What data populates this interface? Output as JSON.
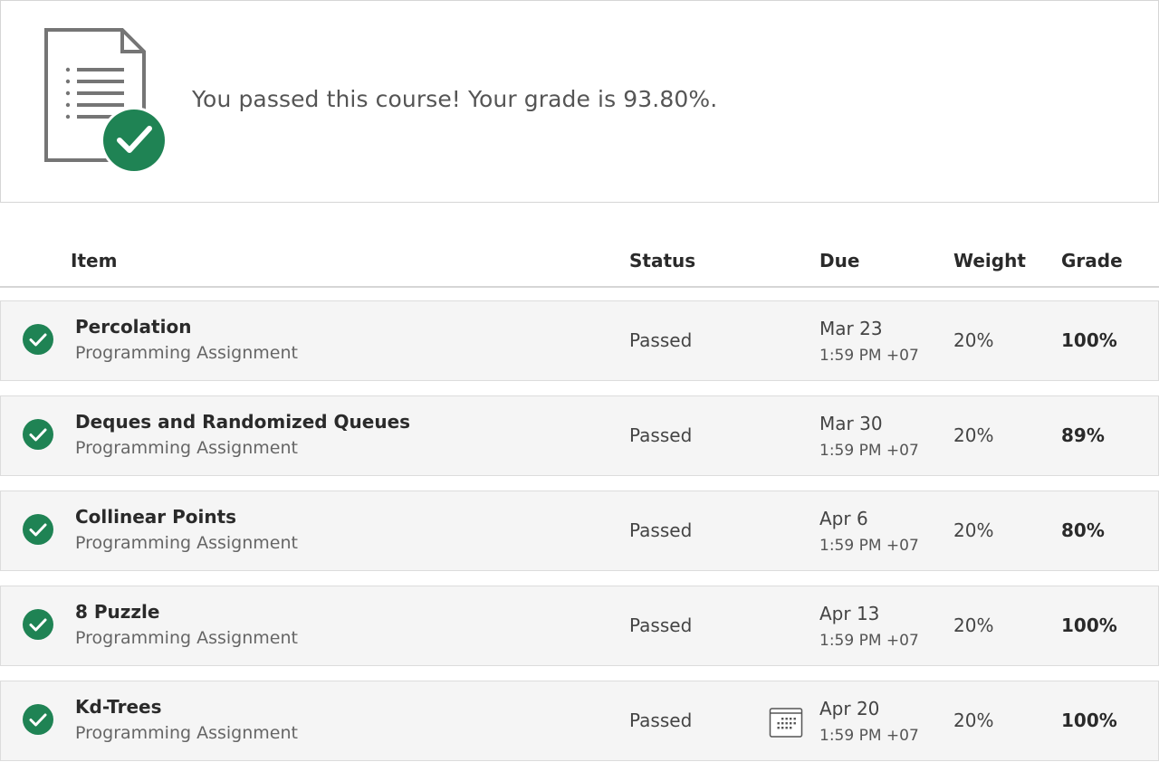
{
  "banner": {
    "message": "You passed this course! Your grade is 93.80%."
  },
  "table": {
    "headers": {
      "item": "Item",
      "status": "Status",
      "due": "Due",
      "weight": "Weight",
      "grade": "Grade"
    },
    "rows": [
      {
        "title": "Percolation",
        "type": "Programming Assignment",
        "status": "Passed",
        "due_date": "Mar 23",
        "due_time": "1:59 PM +07",
        "weight": "20%",
        "grade": "100%",
        "calendar_icon": false
      },
      {
        "title": "Deques and Randomized Queues",
        "type": "Programming Assignment",
        "status": "Passed",
        "due_date": "Mar 30",
        "due_time": "1:59 PM +07",
        "weight": "20%",
        "grade": "89%",
        "calendar_icon": false
      },
      {
        "title": "Collinear Points",
        "type": "Programming Assignment",
        "status": "Passed",
        "due_date": "Apr 6",
        "due_time": "1:59 PM +07",
        "weight": "20%",
        "grade": "80%",
        "calendar_icon": false
      },
      {
        "title": "8 Puzzle",
        "type": "Programming Assignment",
        "status": "Passed",
        "due_date": "Apr 13",
        "due_time": "1:59 PM +07",
        "weight": "20%",
        "grade": "100%",
        "calendar_icon": false
      },
      {
        "title": "Kd-Trees",
        "type": "Programming Assignment",
        "status": "Passed",
        "due_date": "Apr 20",
        "due_time": "1:59 PM +07",
        "weight": "20%",
        "grade": "100%",
        "calendar_icon": true
      }
    ]
  },
  "icons": {
    "passed": "check-circle-icon",
    "document": "document-list-icon",
    "calendar": "calendar-icon"
  },
  "colors": {
    "success_green": "#1f8354",
    "row_background": "#f5f5f5",
    "border": "#d6d6d6",
    "document_gray": "#757575"
  }
}
